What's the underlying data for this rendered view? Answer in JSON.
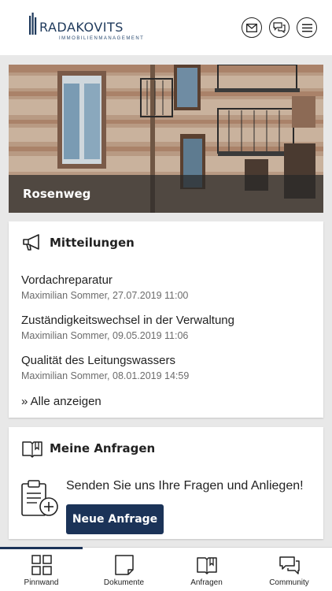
{
  "header": {
    "logo_name": "RADAKOVITS",
    "logo_sub": "IMMOBILIENMANAGEMENT",
    "buttons": [
      {
        "icon": "mail-icon"
      },
      {
        "icon": "chat-icon"
      },
      {
        "icon": "menu-icon"
      }
    ]
  },
  "hero": {
    "title": "Rosenweg"
  },
  "mitteilungen": {
    "title": "Mitteilungen",
    "items": [
      {
        "title": "Vordachreparatur",
        "meta": "Maximilian Sommer, 27.07.2019 11:00"
      },
      {
        "title": "Zuständigkeitswechsel in der Verwaltung",
        "meta": "Maximilian Sommer, 09.05.2019 11:06"
      },
      {
        "title": "Qualität des Leitungswassers",
        "meta": "Maximilian Sommer, 08.01.2019 14:59"
      }
    ],
    "show_all": "» Alle anzeigen"
  },
  "anfragen": {
    "title": "Meine Anfragen",
    "prompt": "Senden Sie uns Ihre Fragen und Anliegen!",
    "button": "Neue Anfrage"
  },
  "tabs": [
    {
      "label": "Pinnwand",
      "icon": "grid-icon",
      "active": true
    },
    {
      "label": "Dokumente",
      "icon": "document-icon",
      "active": false
    },
    {
      "label": "Anfragen",
      "icon": "book-icon",
      "active": false
    },
    {
      "label": "Community",
      "icon": "chat-icon",
      "active": false
    }
  ],
  "colors": {
    "primary": "#1b3358",
    "background": "#e8e8e8",
    "card": "#ffffff"
  }
}
